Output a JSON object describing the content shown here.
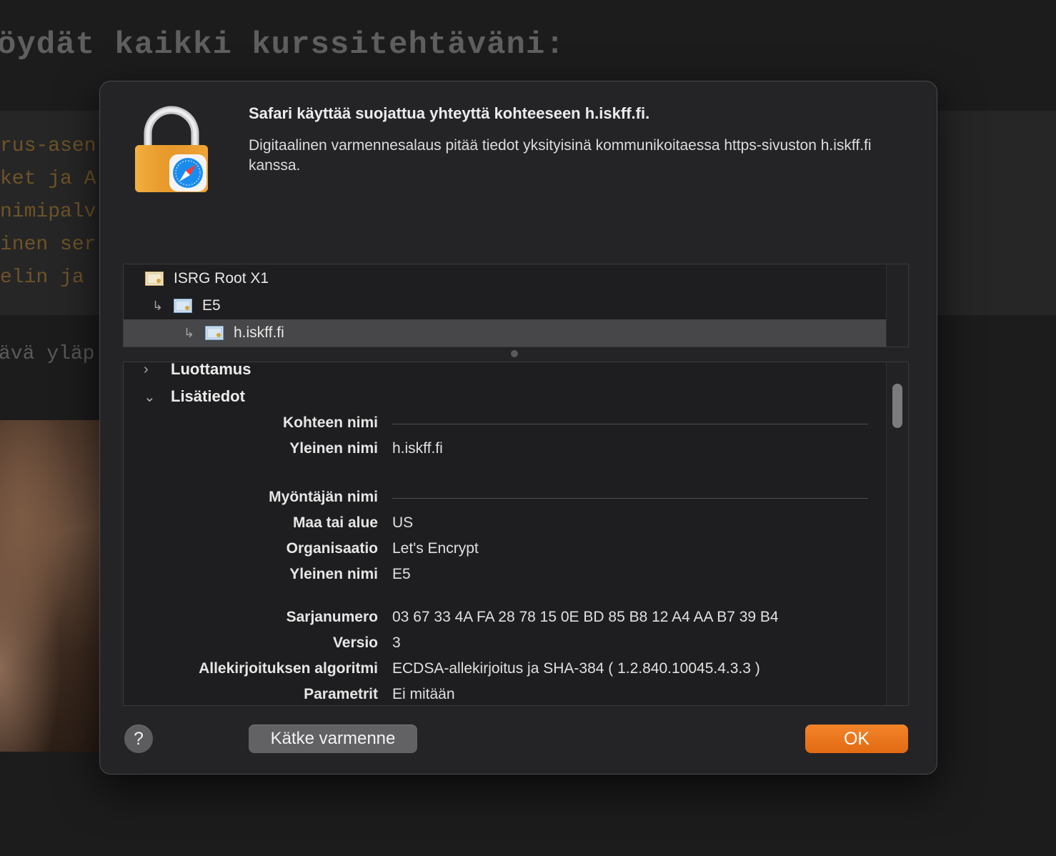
{
  "background": {
    "heading": "öydät kaikki kurssitehtäväni:",
    "lines": [
      "rus-asen",
      "ket ja A",
      "nimipalv",
      "inen ser",
      "elin ja :"
    ],
    "subtext": "ävä yläp"
  },
  "dialog": {
    "title": "Safari käyttää suojattua yhteyttä kohteeseen h.iskff.fi.",
    "description": "Digitaalinen varmennesalaus pitää tiedot yksityisinä kommunikoitaessa https-sivuston h.iskff.fi kanssa.",
    "chain": [
      {
        "name": "ISRG Root X1"
      },
      {
        "name": "E5"
      },
      {
        "name": "h.iskff.fi"
      }
    ],
    "sections": {
      "trust": "Luottamus",
      "details": "Lisätiedot"
    },
    "subject": {
      "heading": "Kohteen nimi",
      "common_name_label": "Yleinen nimi",
      "common_name": "h.iskff.fi"
    },
    "issuer": {
      "heading": "Myöntäjän nimi",
      "country_label": "Maa tai alue",
      "country": "US",
      "org_label": "Organisaatio",
      "org": "Let's Encrypt",
      "common_name_label": "Yleinen nimi",
      "common_name": "E5"
    },
    "fields": {
      "serial_label": "Sarjanumero",
      "serial": "03 67 33 4A FA 28 78 15 0E BD 85 B8 12 A4 AA B7 39 B4",
      "version_label": "Versio",
      "version": "3",
      "sigalg_label": "Allekirjoituksen algoritmi",
      "sigalg": "ECDSA-allekirjoitus ja SHA-384 ( 1.2.840.10045.4.3.3 )",
      "params_label": "Parametrit",
      "params": "Ei mitään"
    },
    "buttons": {
      "help": "?",
      "hide": "Kätke varmenne",
      "ok": "OK"
    }
  },
  "colors": {
    "accent": "#e8741a",
    "dialog_bg": "#242427",
    "selection": "#474749"
  }
}
